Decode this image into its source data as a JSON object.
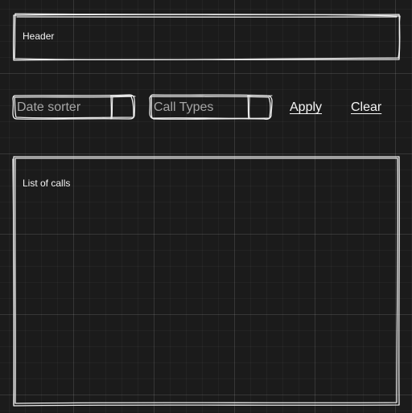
{
  "header": {
    "label": "Header"
  },
  "filters": {
    "date_sorter": {
      "value": "Date sorter",
      "icon": "dropdown-arrow-icon"
    },
    "call_types": {
      "value": "Call Types",
      "icon": "dropdown-arrow-icon"
    },
    "apply_label": "Apply",
    "clear_label": "Clear"
  },
  "list": {
    "label": "List of calls"
  },
  "colors": {
    "background": "#1b1b1b",
    "stroke": "#efefef",
    "placeholder_text": "#a6a6a6",
    "text": "#f2f2f2"
  }
}
